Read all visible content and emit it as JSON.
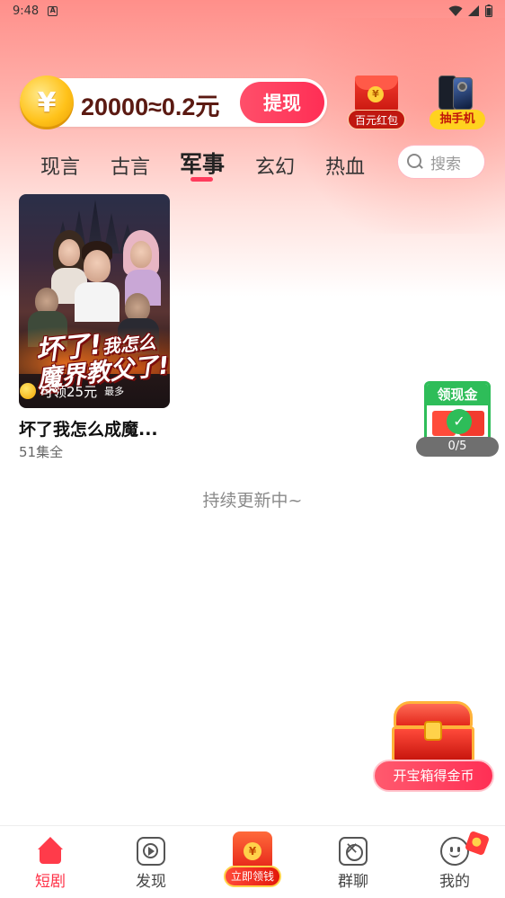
{
  "status_bar": {
    "time": "9:48",
    "app_letter": "A"
  },
  "header": {
    "coin_display": "20000≈0.2元",
    "withdraw_label": "提现",
    "redpack_label": "百元红包",
    "phone_prize_label": "抽手机",
    "coin_symbol": "¥"
  },
  "categories": {
    "tabs": [
      {
        "label": "现言"
      },
      {
        "label": "古言"
      },
      {
        "label": "军事"
      },
      {
        "label": "玄幻"
      },
      {
        "label": "热血"
      }
    ],
    "active": "军事"
  },
  "search": {
    "placeholder": "搜索"
  },
  "dramas": [
    {
      "cover_title_line1a": "坏了!",
      "cover_title_line1b": "我怎么成",
      "cover_title_line2": "魔界教父了!",
      "reward": "可领25元",
      "reward_suffix": "最多",
      "title": "坏了我怎么成魔...",
      "episodes": "51集全"
    }
  ],
  "cash_widget": {
    "header": "领现金",
    "progress": "0/5",
    "progress_value": 0,
    "progress_max": 5
  },
  "footer_note": "持续更新中~",
  "treasure": {
    "button_label": "开宝箱得金币"
  },
  "bottom_nav": {
    "items": [
      {
        "label": "短剧",
        "icon": "home-icon",
        "active": true
      },
      {
        "label": "发现",
        "icon": "play-icon",
        "active": false
      },
      {
        "label": "立即领钱",
        "icon": "money-bag-icon",
        "active": false
      },
      {
        "label": "群聊",
        "icon": "group-chat-icon",
        "active": false
      },
      {
        "label": "我的",
        "icon": "profile-icon",
        "active": false
      }
    ]
  },
  "colors": {
    "accent": "#ff2f55",
    "cash_green": "#2ebd59",
    "coin_gold": "#ffc21a"
  }
}
